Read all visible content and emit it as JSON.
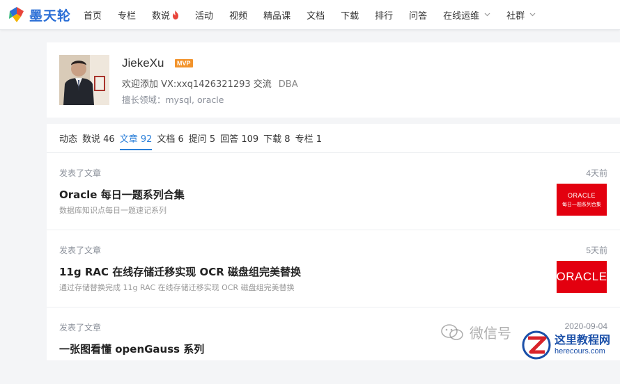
{
  "brand": {
    "name": "墨天轮"
  },
  "nav": {
    "items": [
      "首页",
      "专栏",
      "数说",
      "活动",
      "视频",
      "精品课",
      "文档",
      "下载",
      "排行",
      "问答",
      "在线运维",
      "社群"
    ]
  },
  "profile": {
    "username": "JiekeXu",
    "badge": "MVP",
    "bio": "欢迎添加 VX:xxq1426321293 交流",
    "role": "DBA",
    "skills": "擅长领域：mysql, oracle"
  },
  "tabs": [
    {
      "label": "动态"
    },
    {
      "label": "数说 46"
    },
    {
      "label": "文章 92"
    },
    {
      "label": "文档 6"
    },
    {
      "label": "提问 5"
    },
    {
      "label": "回答 109"
    },
    {
      "label": "下载 8"
    },
    {
      "label": "专栏 1"
    }
  ],
  "articles": [
    {
      "action": "发表了文章",
      "time": "4天前",
      "title": "Oracle 每日一题系列合集",
      "desc": "数据库知识点每日一题速记系列",
      "thumb_brand": "ORACLE",
      "thumb_caption": "每日一题系列合集"
    },
    {
      "action": "发表了文章",
      "time": "5天前",
      "title": "11g RAC 在线存储迁移实现 OCR 磁盘组完美替换",
      "desc": "通过存储替换完成 11g RAC 在线存储迁移实现 OCR 磁盘组完美替换",
      "thumb_brand": "ORACLE"
    },
    {
      "action": "发表了文章",
      "time": "2020-09-04",
      "title": "一张图看懂 openGauss 系列"
    }
  ],
  "watermarks": {
    "wechat": "微信号",
    "site_cn": "这里教程网",
    "site_en": "herecours.com"
  },
  "colors": {
    "accent": "#2b7fd9",
    "brand_blue": "#2b6fd6",
    "mvp_orange": "#f2932b",
    "oracle_red": "#e3000f"
  }
}
